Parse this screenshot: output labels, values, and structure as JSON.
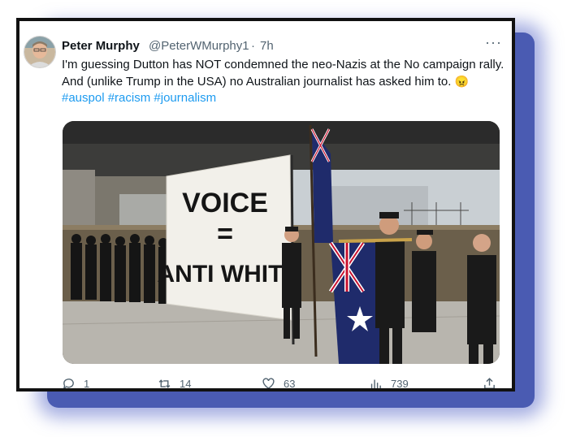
{
  "tweet": {
    "author_name": "Peter Murphy",
    "handle": "@PeterWMurphy1",
    "separator": "·",
    "time": "7h",
    "more_label": "···",
    "text_main": "I'm guessing Dutton has NOT condemned the neo-Nazis at the No campaign rally. And (unlike Trump in the USA) no Australian journalist has asked him to.",
    "emoji": "😠",
    "hashtags": [
      "#auspol",
      "#racism",
      "#journalism"
    ]
  },
  "image": {
    "banner_line1": "VOICE",
    "banner_line2": "=",
    "banner_line3": "ANTI WHITE"
  },
  "actions": {
    "reply_count": "1",
    "retweet_count": "14",
    "like_count": "63",
    "views_count": "739"
  },
  "colors": {
    "link": "#1d9bf0",
    "secondary_text": "#536471",
    "shadow": "#4a5bb2"
  }
}
